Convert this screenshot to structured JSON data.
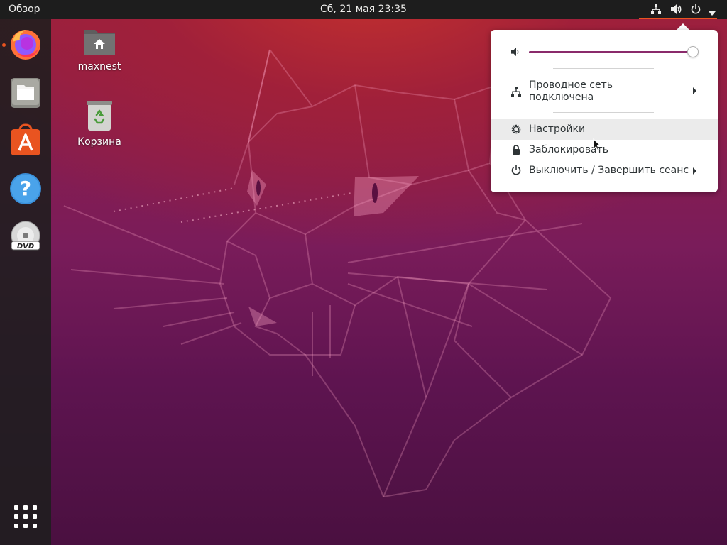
{
  "topbar": {
    "activities_label": "Обзор",
    "clock": "Сб, 21 мая  23:35",
    "tray_icons": [
      "network-wired-icon",
      "volume-icon",
      "power-icon",
      "dropdown-arrow-icon"
    ]
  },
  "dock": {
    "items": [
      {
        "name": "firefox",
        "icon": "firefox-icon",
        "running": true
      },
      {
        "name": "files",
        "icon": "files-icon",
        "running": false
      },
      {
        "name": "ubuntu-software",
        "icon": "ubuntu-software-icon",
        "running": false
      },
      {
        "name": "help",
        "icon": "help-icon",
        "running": false
      },
      {
        "name": "dvd",
        "icon": "dvd-icon",
        "running": false
      }
    ],
    "show_apps_icon": "app-grid-icon",
    "accent_color": "#e95420"
  },
  "desktop": {
    "icons": [
      {
        "label": "maxnest",
        "icon": "home-folder-icon"
      },
      {
        "label": "Корзина",
        "icon": "trash-icon"
      }
    ]
  },
  "system_menu": {
    "volume": {
      "level": 0.99,
      "icon": "volume-icon"
    },
    "network": {
      "label_line1": "Проводное сеть",
      "label_line2": "подключена",
      "icon": "network-wired-icon"
    },
    "settings": {
      "label": "Настройки",
      "icon": "gear-icon"
    },
    "lock": {
      "label": "Заблокировать",
      "icon": "lock-icon"
    },
    "power": {
      "label": "Выключить / Завершить сеанс",
      "icon": "power-icon"
    }
  },
  "colors": {
    "topbar_bg": "#1d1d1d",
    "menu_highlight": "#ebebeb",
    "slider_fill": "#8a2a6b"
  }
}
